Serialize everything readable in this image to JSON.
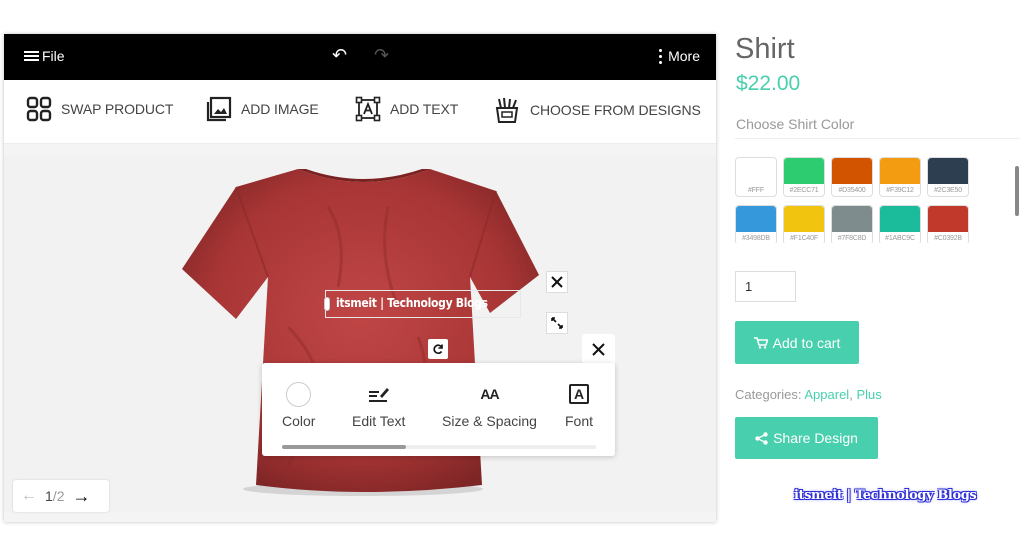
{
  "designer": {
    "topbar": {
      "file_label": "File",
      "more_label": "More"
    },
    "toolbar": {
      "swap_product": "SWAP PRODUCT",
      "add_image": "ADD IMAGE",
      "add_text": "ADD TEXT",
      "choose_designs": "CHOOSE FROM DESIGNS"
    },
    "shirt_color": "#B33A3A",
    "text_layer": "itsmeit | Technology Blogs",
    "text_options": {
      "color": "Color",
      "edit_text": "Edit Text",
      "size_spacing": "Size & Spacing",
      "font": "Font",
      "size_icon_text": "AA",
      "font_icon_text": "A"
    },
    "pager": {
      "current": "1",
      "separator": "/",
      "total": "2"
    }
  },
  "product": {
    "title": "Shirt",
    "price": "$22.00",
    "color_label": "Choose Shirt Color",
    "swatches": [
      {
        "hex": "#FFF"
      },
      {
        "hex": "#2ECC71"
      },
      {
        "hex": "#D35400"
      },
      {
        "hex": "#F39C12"
      },
      {
        "hex": "#2C3E50"
      },
      {
        "hex": "#3498DB"
      },
      {
        "hex": "#F1C40F"
      },
      {
        "hex": "#7F8C8D"
      },
      {
        "hex": "#1ABC9C"
      },
      {
        "hex": "#C0392B"
      }
    ],
    "quantity": "1",
    "add_to_cart": "Add to cart",
    "categories_label": "Categories:",
    "categories": [
      "Apparel",
      "Plus"
    ],
    "category_separator": ", ",
    "share_design": "Share Design",
    "watermark": "itsmeit | Technology Blogs"
  }
}
